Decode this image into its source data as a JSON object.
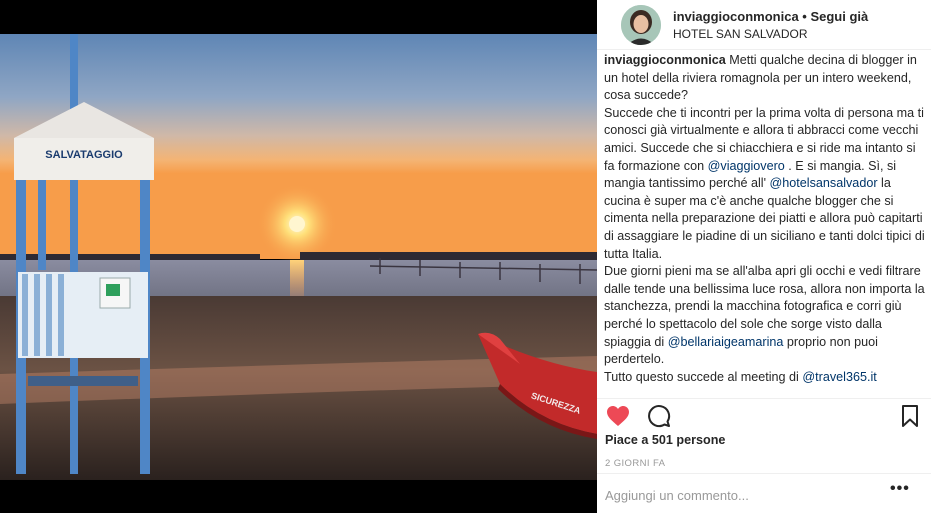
{
  "post": {
    "image_alt": "Alba sulla spiaggia con torretta di salvataggio",
    "tower_sign": "SALVATAGGIO",
    "boat_text": "SICUREZZA",
    "header": {
      "username": "inviaggioconmonica",
      "separator": " • ",
      "follow_label": "Segui già",
      "location": "HOTEL SAN SALVADOR"
    },
    "caption": {
      "username": "inviaggioconmonica",
      "p1_text": " Metti qualche decina di blogger in un hotel della riviera romagnola per un intero weekend, cosa succede?",
      "p2_a": "Succede che ti incontri per la prima volta di persona ma ti conosci già virtualmente e allora ti abbracci come vecchi amici. Succede che si chiacchiera e si ride ma intanto si fa formazione con ",
      "p2_mention1": "@viaggiovero",
      "p2_b": " . E si mangia. Sì, si mangia tantissimo perché all' ",
      "p2_mention2": "@hotelsansalvador",
      "p2_c": " la cucina è super ma c'è anche qualche blogger che si cimenta nella preparazione dei piatti e allora può capitarti di assaggiare le piadine di un siciliano e tanti dolci tipici di tutta Italia.",
      "p3_a": "Due giorni pieni ma se all'alba apri gli occhi e vedi filtrare dalle tende una bellissima luce rosa, allora non importa la stanchezza, prendi la macchina fotografica e corri giù perché lo spettacolo del sole che sorge visto dalla spiaggia di ",
      "p3_mention": "@bellariaigeamarina",
      "p3_b": " proprio non puoi perdertelo.",
      "p4_a": "Tutto questo succede al meeting di ",
      "p4_mention": "@travel365.it"
    },
    "actions": {
      "like_icon": "heart-icon",
      "comment_icon": "comment-icon",
      "save_icon": "bookmark-icon",
      "like_color": "#ed4956"
    },
    "likes_text": "Piace a 501 persone",
    "timestamp": "2 GIORNI FA",
    "comment": {
      "placeholder": "Aggiungi un commento...",
      "more_label": "•••"
    }
  }
}
